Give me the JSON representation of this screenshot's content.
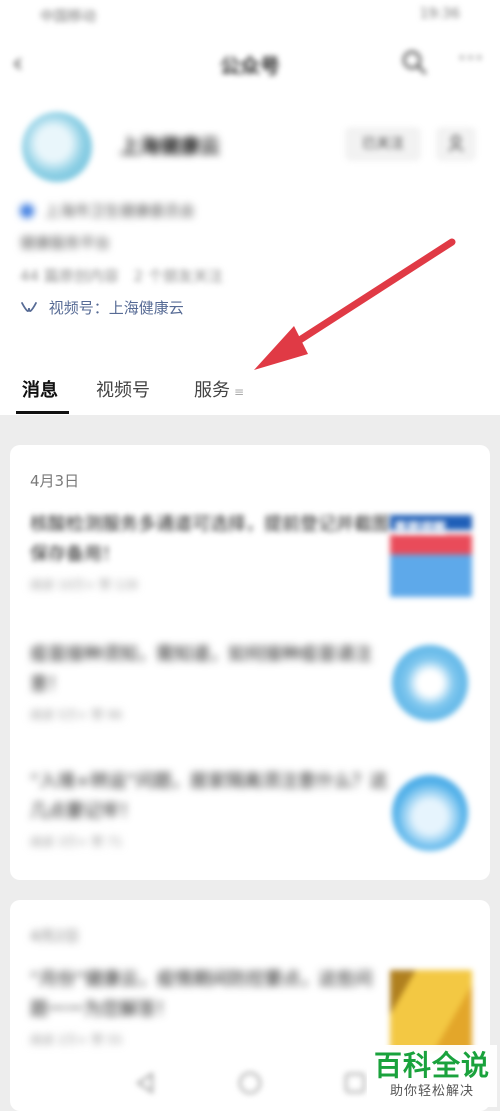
{
  "status_bar": {
    "left": "中国移动",
    "right": "19:36"
  },
  "header": {
    "title": "公众号"
  },
  "account": {
    "name": "上海健康云",
    "follow_label": "已关注",
    "verification": "上海市卫生健康委员会",
    "intro": "健康服务平台",
    "articles_count": "44 篇原创内容",
    "friends_following": "2 个朋友关注",
    "channel": "视频号：上海健康云"
  },
  "tabs": [
    {
      "label": "消息",
      "active": true
    },
    {
      "label": "视频号",
      "active": false
    },
    {
      "label": "服务",
      "active": false
    }
  ],
  "feed": [
    {
      "date": "4月3日",
      "articles": [
        {
          "title": "核酸检测服务多通道可选择，提前登记并截图保存备用！",
          "meta": "阅读 10万+  赞 128",
          "thumb_label": "重要提醒"
        },
        {
          "title": "疫苗接种须知，需知道，如何接种疫苗请注意！",
          "meta": "阅读 5万+  赞 96"
        },
        {
          "title": "“入境+转运”问题，居家隔离须注意什么？这几点要记牢！",
          "meta": "阅读 3万+  赞 71"
        }
      ]
    },
    {
      "date": "4月2日",
      "articles": [
        {
          "title": "“月份”健康云，疫情期间防控要点，这些问题一一为您解答！",
          "meta": "阅读 2万+  赞 55"
        }
      ]
    }
  ],
  "watermark": {
    "name": "百科全说",
    "slogan": "助你轻松解决"
  },
  "colors": {
    "link": "#576b95",
    "arrow": "#e03a45",
    "brand_green": "#1aa23c"
  }
}
